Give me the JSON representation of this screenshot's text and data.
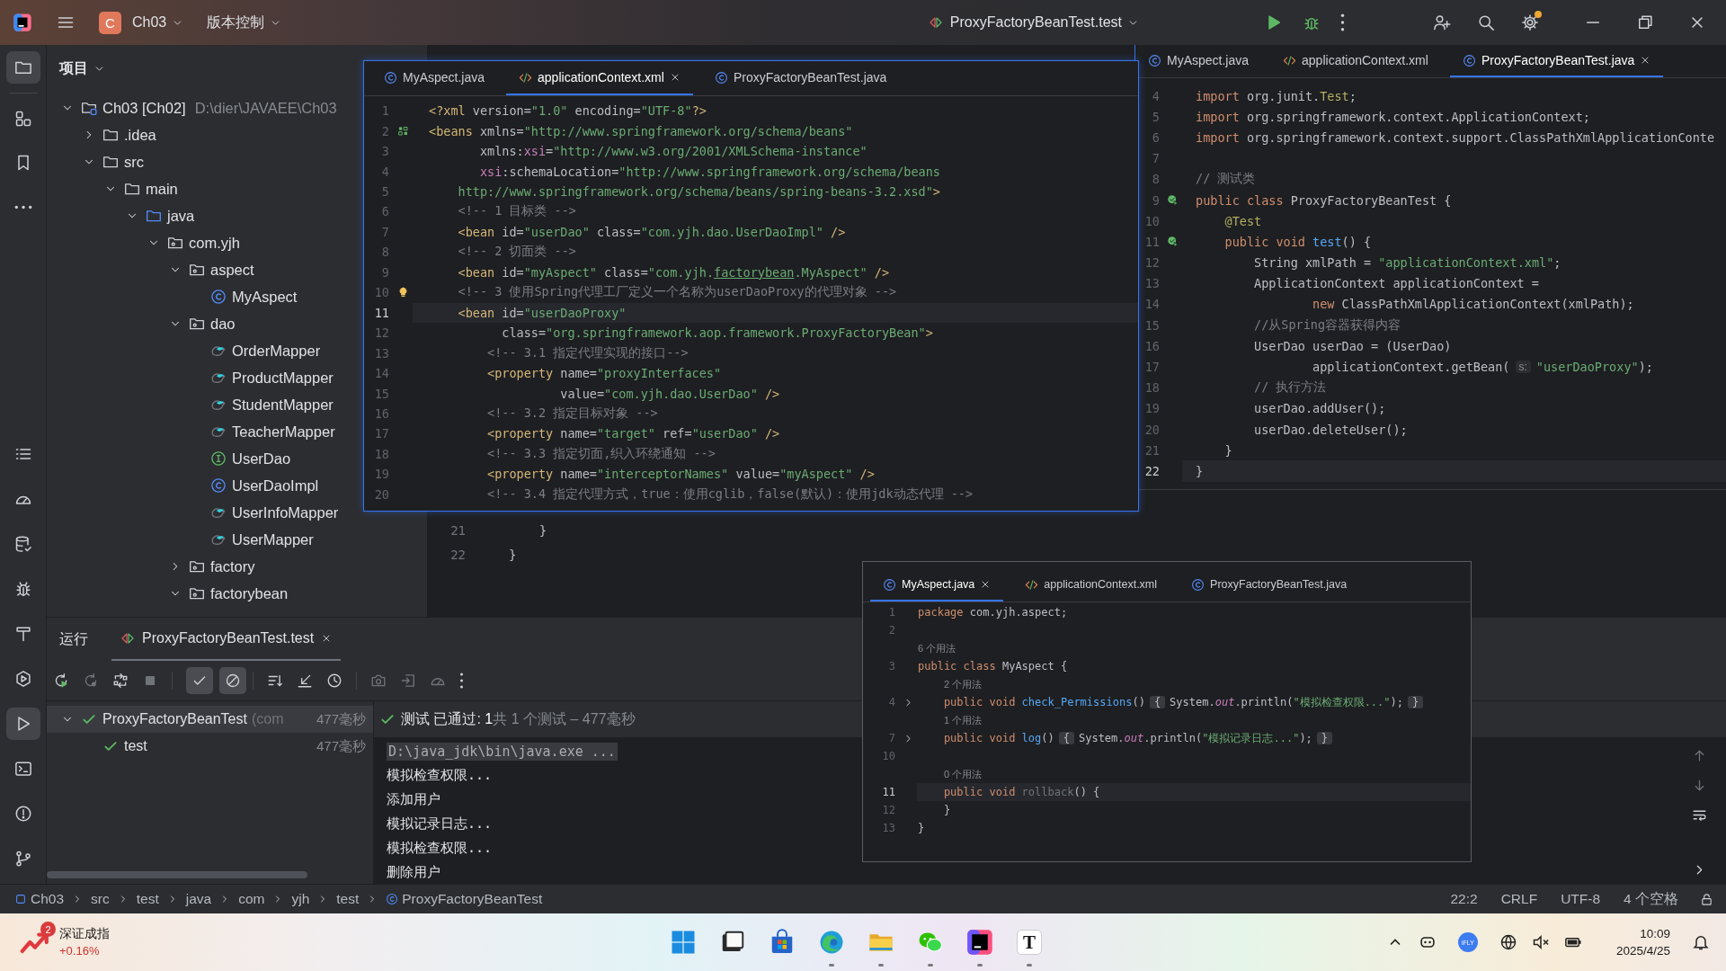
{
  "title_bar": {
    "project_badge": "C",
    "project": "Ch03",
    "vcs": "版本控制",
    "run_config": "ProxyFactoryBeanTest.test",
    "settings_notification": true
  },
  "tool_strip": {
    "top": [
      {
        "kind": "project",
        "selected": true
      },
      {
        "kind": "structure",
        "selected": false
      },
      {
        "kind": "bookmarks",
        "selected": false
      },
      {
        "kind": "more",
        "selected": false
      }
    ],
    "bottom": [
      {
        "kind": "todo",
        "selected": false
      },
      {
        "kind": "profiler",
        "selected": false
      },
      {
        "kind": "database",
        "selected": false
      },
      {
        "kind": "debug",
        "selected": false
      },
      {
        "kind": "build",
        "selected": false
      },
      {
        "kind": "services",
        "selected": false
      },
      {
        "kind": "run",
        "selected": true
      },
      {
        "kind": "terminal",
        "selected": false
      },
      {
        "kind": "problems",
        "selected": false
      },
      {
        "kind": "git",
        "selected": false
      }
    ]
  },
  "project_panel": {
    "title": "项目",
    "tree": [
      {
        "kind": "module",
        "label": "Ch03 [Ch02]",
        "hint": "D:\\dier\\JAVAEE\\Ch03",
        "expanded": true,
        "children": [
          {
            "kind": "folder",
            "label": ".idea",
            "expanded": false
          },
          {
            "kind": "folder",
            "label": "src",
            "expanded": true,
            "children": [
              {
                "kind": "folder",
                "label": "main",
                "expanded": true,
                "children": [
                  {
                    "kind": "source-folder",
                    "label": "java",
                    "expanded": true,
                    "children": [
                      {
                        "kind": "package",
                        "label": "com.yjh",
                        "expanded": true,
                        "children": [
                          {
                            "kind": "package",
                            "label": "aspect",
                            "expanded": true,
                            "children": [
                              {
                                "kind": "class",
                                "label": "MyAspect"
                              }
                            ]
                          },
                          {
                            "kind": "package",
                            "label": "dao",
                            "expanded": true,
                            "children": [
                              {
                                "kind": "mapper",
                                "label": "OrderMapper"
                              },
                              {
                                "kind": "mapper",
                                "label": "ProductMapper"
                              },
                              {
                                "kind": "mapper",
                                "label": "StudentMapper"
                              },
                              {
                                "kind": "mapper",
                                "label": "TeacherMapper"
                              },
                              {
                                "kind": "interface",
                                "label": "UserDao"
                              },
                              {
                                "kind": "class",
                                "label": "UserDaoImpl"
                              },
                              {
                                "kind": "mapper",
                                "label": "UserInfoMapper"
                              },
                              {
                                "kind": "mapper",
                                "label": "UserMapper"
                              }
                            ]
                          },
                          {
                            "kind": "package",
                            "label": "factory",
                            "expanded": false
                          },
                          {
                            "kind": "package",
                            "label": "factorybean",
                            "expanded": true
                          }
                        ]
                      }
                    ]
                  }
                ]
              }
            ]
          }
        ]
      }
    ]
  },
  "main_editor": {
    "lines": [
      {
        "number": "21",
        "spans": [
          {
            "kind": "plain",
            "text": "    }"
          }
        ]
      },
      {
        "number": "22",
        "spans": [
          {
            "kind": "plain",
            "text": "}"
          }
        ]
      }
    ]
  },
  "editor_windows": [
    {
      "tabs": [
        {
          "kind": "class",
          "label": "MyAspect.java",
          "selected": false
        },
        {
          "kind": "xml",
          "label": "applicationContext.xml",
          "selected": true
        },
        {
          "kind": "class",
          "label": "ProxyFactoryBeanTest.java",
          "selected": false
        }
      ],
      "lines": [
        {
          "kind": "code",
          "number": "1",
          "spans": [
            {
              "kind": "tag",
              "text": "<?xml"
            },
            {
              "kind": "attr",
              "text": " version="
            },
            {
              "kind": "string",
              "text": "\"1.0\""
            },
            {
              "kind": "attr",
              "text": " encoding="
            },
            {
              "kind": "string",
              "text": "\"UTF-8\""
            },
            {
              "kind": "tag",
              "text": "?>"
            }
          ]
        },
        {
          "kind": "code",
          "number": "2",
          "gutter_icon": {
            "kind": "bean"
          },
          "spans": [
            {
              "kind": "tag",
              "text": "<beans"
            },
            {
              "kind": "attr",
              "text": " xmlns="
            },
            {
              "kind": "string",
              "text": "\"http://www.springframework.org/schema/beans\""
            }
          ]
        },
        {
          "kind": "code",
          "number": "3",
          "spans": [
            {
              "kind": "attr",
              "text": "       xmlns:"
            },
            {
              "kind": "namespace",
              "text": "xsi"
            },
            {
              "kind": "attr",
              "text": "="
            },
            {
              "kind": "string",
              "text": "\"http://www.w3.org/2001/XMLSchema-instance\""
            }
          ]
        },
        {
          "kind": "code",
          "number": "4",
          "spans": [
            {
              "kind": "namespace",
              "text": "       xsi"
            },
            {
              "kind": "attr",
              "text": ":schemaLocation="
            },
            {
              "kind": "string",
              "text": "\"http://www.springframework.org/schema/beans"
            }
          ]
        },
        {
          "kind": "code",
          "number": "5",
          "spans": [
            {
              "kind": "string",
              "text": "    http://www.springframework.org/schema/beans/spring-beans-3.2.xsd\""
            },
            {
              "kind": "tag",
              "text": ">"
            }
          ]
        },
        {
          "kind": "code",
          "number": "6",
          "spans": [
            {
              "kind": "comment",
              "text": "    <!-- 1 目标类 -->"
            }
          ]
        },
        {
          "kind": "code",
          "number": "7",
          "spans": [
            {
              "kind": "tag",
              "text": "    <bean"
            },
            {
              "kind": "attr",
              "text": " id="
            },
            {
              "kind": "string",
              "text": "\"userDao\""
            },
            {
              "kind": "attr",
              "text": " class="
            },
            {
              "kind": "string",
              "text": "\"com.yjh.dao.UserDaoImpl\""
            },
            {
              "kind": "tag",
              "text": " />"
            }
          ]
        },
        {
          "kind": "code",
          "number": "8",
          "spans": [
            {
              "kind": "comment",
              "text": "    <!-- 2 切面类 -->"
            }
          ]
        },
        {
          "kind": "code",
          "number": "9",
          "spans": [
            {
              "kind": "tag",
              "text": "    <bean"
            },
            {
              "kind": "attr",
              "text": " id="
            },
            {
              "kind": "string",
              "text": "\"myAspect\""
            },
            {
              "kind": "attr",
              "text": " class="
            },
            {
              "kind": "string",
              "text": "\"com.yjh."
            },
            {
              "kind": "link",
              "text": "factorybean"
            },
            {
              "kind": "string",
              "text": ".MyAspect\""
            },
            {
              "kind": "tag",
              "text": " />"
            }
          ]
        },
        {
          "kind": "code",
          "number": "10",
          "gutter_icon": {
            "kind": "bulb"
          },
          "spans": [
            {
              "kind": "comment",
              "text": "    <!-- 3 使用Spring代理工厂定义一个名称为userDaoProxy的代理对象 -->"
            }
          ]
        },
        {
          "kind": "code",
          "number": "11",
          "current": true,
          "spans": [
            {
              "kind": "tag",
              "text": "    <bean"
            },
            {
              "kind": "attr",
              "text": " id="
            },
            {
              "kind": "string",
              "text": "\"userDaoProxy\""
            }
          ]
        },
        {
          "kind": "code",
          "number": "12",
          "spans": [
            {
              "kind": "attr",
              "text": "          class="
            },
            {
              "kind": "string",
              "text": "\"org.springframework.aop.framework.ProxyFactoryBean\""
            },
            {
              "kind": "tag",
              "text": ">"
            }
          ]
        },
        {
          "kind": "code",
          "number": "13",
          "spans": [
            {
              "kind": "comment",
              "text": "        <!-- 3.1 指定代理实现的接口-->"
            }
          ]
        },
        {
          "kind": "code",
          "number": "14",
          "spans": [
            {
              "kind": "tag",
              "text": "        <property"
            },
            {
              "kind": "attr",
              "text": " name="
            },
            {
              "kind": "string",
              "text": "\"proxyInterfaces\""
            }
          ]
        },
        {
          "kind": "code",
          "number": "15",
          "spans": [
            {
              "kind": "attr",
              "text": "                  value="
            },
            {
              "kind": "string",
              "text": "\"com.yjh.dao.UserDao\""
            },
            {
              "kind": "tag",
              "text": " />"
            }
          ]
        },
        {
          "kind": "code",
          "number": "16",
          "spans": [
            {
              "kind": "comment",
              "text": "        <!-- 3.2 指定目标对象 -->"
            }
          ]
        },
        {
          "kind": "code",
          "number": "17",
          "spans": [
            {
              "kind": "tag",
              "text": "        <property"
            },
            {
              "kind": "attr",
              "text": " name="
            },
            {
              "kind": "string",
              "text": "\"target\""
            },
            {
              "kind": "attr",
              "text": " ref="
            },
            {
              "kind": "string",
              "text": "\"userDao\""
            },
            {
              "kind": "tag",
              "text": " />"
            }
          ]
        },
        {
          "kind": "code",
          "number": "18",
          "spans": [
            {
              "kind": "comment",
              "text": "        <!-- 3.3 指定切面,织入环绕通知 -->"
            }
          ]
        },
        {
          "kind": "code",
          "number": "19",
          "spans": [
            {
              "kind": "tag",
              "text": "        <property"
            },
            {
              "kind": "attr",
              "text": " name="
            },
            {
              "kind": "string",
              "text": "\"interceptorNames\""
            },
            {
              "kind": "attr",
              "text": " value="
            },
            {
              "kind": "string",
              "text": "\"myAspect\""
            },
            {
              "kind": "tag",
              "text": " />"
            }
          ]
        },
        {
          "kind": "code",
          "number": "20",
          "spans": [
            {
              "kind": "comment",
              "text": "        <!-- 3.4 指定代理方式，true：使用cglib，false(默认)：使用jdk动态代理 -->"
            }
          ]
        }
      ]
    },
    {
      "tabs": [
        {
          "kind": "class",
          "label": "MyAspect.java",
          "selected": false
        },
        {
          "kind": "xml",
          "label": "applicationContext.xml",
          "selected": false
        },
        {
          "kind": "class",
          "label": "ProxyFactoryBeanTest.java",
          "selected": true
        }
      ],
      "lines": [
        {
          "kind": "code",
          "number": "4",
          "spans": [
            {
              "kind": "keyword",
              "text": "import"
            },
            {
              "kind": "plain",
              "text": " org.junit."
            },
            {
              "kind": "annotation",
              "text": "Test"
            },
            {
              "kind": "plain",
              "text": ";"
            }
          ]
        },
        {
          "kind": "code",
          "number": "5",
          "spans": [
            {
              "kind": "keyword",
              "text": "import"
            },
            {
              "kind": "plain",
              "text": " org.springframework.context.ApplicationContext;"
            }
          ]
        },
        {
          "kind": "code",
          "number": "6",
          "spans": [
            {
              "kind": "keyword",
              "text": "import"
            },
            {
              "kind": "plain",
              "text": " org.springframework.context.support.ClassPathXmlApplicationConte"
            }
          ]
        },
        {
          "kind": "code",
          "number": "7"
        },
        {
          "kind": "code",
          "number": "8",
          "spans": [
            {
              "kind": "comment",
              "text": "// 测试类"
            }
          ]
        },
        {
          "kind": "code",
          "number": "9",
          "gutter_icon": {
            "kind": "run"
          },
          "spans": [
            {
              "kind": "keyword",
              "text": "public class"
            },
            {
              "kind": "plain",
              "text": " ProxyFactoryBeanTest {"
            }
          ]
        },
        {
          "kind": "code",
          "number": "10",
          "spans": [
            {
              "kind": "annotation",
              "text": "    @Test"
            }
          ]
        },
        {
          "kind": "code",
          "number": "11",
          "gutter_icon": {
            "kind": "run"
          },
          "spans": [
            {
              "kind": "keyword",
              "text": "    public void"
            },
            {
              "kind": "method",
              "text": " test"
            },
            {
              "kind": "plain",
              "text": "() {"
            }
          ]
        },
        {
          "kind": "code",
          "number": "12",
          "spans": [
            {
              "kind": "plain",
              "text": "        String xmlPath = "
            },
            {
              "kind": "string",
              "text": "\"applicationContext.xml\""
            },
            {
              "kind": "plain",
              "text": ";"
            }
          ]
        },
        {
          "kind": "code",
          "number": "13",
          "spans": [
            {
              "kind": "plain",
              "text": "        ApplicationContext applicationContext ="
            }
          ]
        },
        {
          "kind": "code",
          "number": "14",
          "spans": [
            {
              "kind": "keyword",
              "text": "                new"
            },
            {
              "kind": "plain",
              "text": " ClassPathXmlApplicationContext(xmlPath);"
            }
          ]
        },
        {
          "kind": "code",
          "number": "15",
          "spans": [
            {
              "kind": "comment",
              "text": "        //从Spring容器获得内容"
            }
          ]
        },
        {
          "kind": "code",
          "number": "16",
          "spans": [
            {
              "kind": "plain",
              "text": "        UserDao userDao = (UserDao)"
            }
          ]
        },
        {
          "kind": "code",
          "number": "17",
          "spans": [
            {
              "kind": "plain",
              "text": "                applicationContext.getBean("
            },
            {
              "kind": "param-hint",
              "text": "s:"
            },
            {
              "kind": "string",
              "text": "\"userDaoProxy\""
            },
            {
              "kind": "plain",
              "text": ");"
            }
          ]
        },
        {
          "kind": "code",
          "number": "18",
          "spans": [
            {
              "kind": "comment",
              "text": "        // 执行方法"
            }
          ]
        },
        {
          "kind": "code",
          "number": "19",
          "spans": [
            {
              "kind": "plain",
              "text": "        userDao.addUser();"
            }
          ]
        },
        {
          "kind": "code",
          "number": "20",
          "spans": [
            {
              "kind": "plain",
              "text": "        userDao.deleteUser();"
            }
          ]
        },
        {
          "kind": "code",
          "number": "21",
          "spans": [
            {
              "kind": "plain",
              "text": "    }"
            }
          ]
        },
        {
          "kind": "code",
          "number": "22",
          "current": true,
          "spans": [
            {
              "kind": "plain",
              "text": "}"
            }
          ]
        }
      ]
    },
    {
      "tabs": [
        {
          "kind": "class",
          "label": "MyAspect.java",
          "selected": true
        },
        {
          "kind": "xml",
          "label": "applicationContext.xml",
          "selected": false
        },
        {
          "kind": "class",
          "label": "ProxyFactoryBeanTest.java",
          "selected": false
        }
      ],
      "lines": [
        {
          "kind": "code",
          "number": "1",
          "spans": [
            {
              "kind": "keyword",
              "text": "package"
            },
            {
              "kind": "plain",
              "text": " com.yjh.aspect;"
            }
          ]
        },
        {
          "kind": "code",
          "number": "2"
        },
        {
          "kind": "usage",
          "text": "6 个用法"
        },
        {
          "kind": "code",
          "number": "3",
          "spans": [
            {
              "kind": "keyword",
              "text": "public class"
            },
            {
              "kind": "plain",
              "text": " MyAspect {"
            }
          ]
        },
        {
          "kind": "usage",
          "text": "2 个用法"
        },
        {
          "kind": "code",
          "number": "4",
          "gutter_icon": {
            "kind": "folded"
          },
          "spans": [
            {
              "kind": "keyword",
              "text": "    public void"
            },
            {
              "kind": "method",
              "text": " check_Permissions"
            },
            {
              "kind": "plain",
              "text": "()"
            },
            {
              "kind": "folded",
              "text": "{"
            },
            {
              "kind": "plain",
              "text": "System."
            },
            {
              "kind": "field",
              "text": "out"
            },
            {
              "kind": "plain",
              "text": ".println("
            },
            {
              "kind": "string",
              "text": "\"模拟检查权限...\""
            },
            {
              "kind": "plain",
              "text": ");"
            },
            {
              "kind": "folded",
              "text": "}"
            }
          ]
        },
        {
          "kind": "usage",
          "text": "1 个用法"
        },
        {
          "kind": "code",
          "number": "7",
          "gutter_icon": {
            "kind": "folded"
          },
          "spans": [
            {
              "kind": "keyword",
              "text": "    public void"
            },
            {
              "kind": "method",
              "text": " log"
            },
            {
              "kind": "plain",
              "text": "()"
            },
            {
              "kind": "folded",
              "text": "{"
            },
            {
              "kind": "plain",
              "text": "System."
            },
            {
              "kind": "field",
              "text": "out"
            },
            {
              "kind": "plain",
              "text": ".println("
            },
            {
              "kind": "string",
              "text": "\"模拟记录日志...\""
            },
            {
              "kind": "plain",
              "text": ");"
            },
            {
              "kind": "folded",
              "text": "}"
            }
          ]
        },
        {
          "kind": "code",
          "number": "10"
        },
        {
          "kind": "usage",
          "text": "0 个用法"
        },
        {
          "kind": "code",
          "number": "11",
          "current": true,
          "spans": [
            {
              "kind": "keyword",
              "text": "    public void"
            },
            {
              "kind": "unused",
              "text": " rollback"
            },
            {
              "kind": "plain",
              "text": "() {"
            }
          ]
        },
        {
          "kind": "code",
          "number": "12",
          "spans": [
            {
              "kind": "plain",
              "text": "    }"
            }
          ]
        },
        {
          "kind": "code",
          "number": "13",
          "spans": [
            {
              "kind": "plain",
              "text": "}"
            }
          ]
        }
      ]
    }
  ],
  "run_panel": {
    "title": "运行",
    "tabs": [
      {
        "label": "ProxyFactoryBeanTest.test",
        "selected": true
      }
    ],
    "filters": [
      {
        "kind": "passed",
        "on": true
      },
      {
        "kind": "ignored",
        "on": true
      }
    ],
    "tests": [
      {
        "label": "ProxyFactoryBeanTest",
        "hint": "(com",
        "time": "477毫秒",
        "passed": true,
        "expanded": true,
        "selected": true,
        "children": [
          {
            "label": "test",
            "time": "477毫秒",
            "passed": true,
            "selected": false
          }
        ]
      }
    ],
    "summary": {
      "passed": true,
      "status": "测试 已通过:",
      "count": "1",
      "detail": "共 1 个测试 – 477毫秒"
    },
    "console": [
      {
        "kind": "command",
        "text": "D:\\java_jdk\\bin\\java.exe ..."
      },
      {
        "kind": "output",
        "text": "模拟检查权限..."
      },
      {
        "kind": "output",
        "text": "添加用户"
      },
      {
        "kind": "output",
        "text": "模拟记录日志..."
      },
      {
        "kind": "output",
        "text": "模拟检查权限..."
      },
      {
        "kind": "output",
        "text": "删除用户"
      }
    ]
  },
  "status_bar": {
    "breadcrumbs": [
      {
        "kind": "module",
        "label": "Ch03"
      },
      {
        "kind": "folder",
        "label": "src"
      },
      {
        "kind": "folder",
        "label": "test"
      },
      {
        "kind": "folder",
        "label": "java"
      },
      {
        "kind": "folder",
        "label": "com"
      },
      {
        "kind": "folder",
        "label": "yjh"
      },
      {
        "kind": "folder",
        "label": "test"
      },
      {
        "kind": "class",
        "label": "ProxyFactoryBeanTest"
      }
    ],
    "position": "22:2",
    "line_ending": "CRLF",
    "encoding": "UTF-8",
    "indent": "4 个空格"
  },
  "taskbar": {
    "widget": {
      "badge": "2",
      "name": "深证成指",
      "change": "+0.16%"
    },
    "apps": [
      {
        "kind": "start",
        "running": false
      },
      {
        "kind": "task-view",
        "running": false
      },
      {
        "kind": "store",
        "running": false
      },
      {
        "kind": "edge",
        "running": true
      },
      {
        "kind": "explorer",
        "running": true
      },
      {
        "kind": "wechat",
        "running": true
      },
      {
        "kind": "intellij",
        "running": true
      },
      {
        "kind": "letter",
        "glyph": "T",
        "running": true
      }
    ],
    "tray": {
      "ime": "iFLY"
    },
    "clock": {
      "time": "10:09",
      "date": "2025/4/25"
    }
  }
}
